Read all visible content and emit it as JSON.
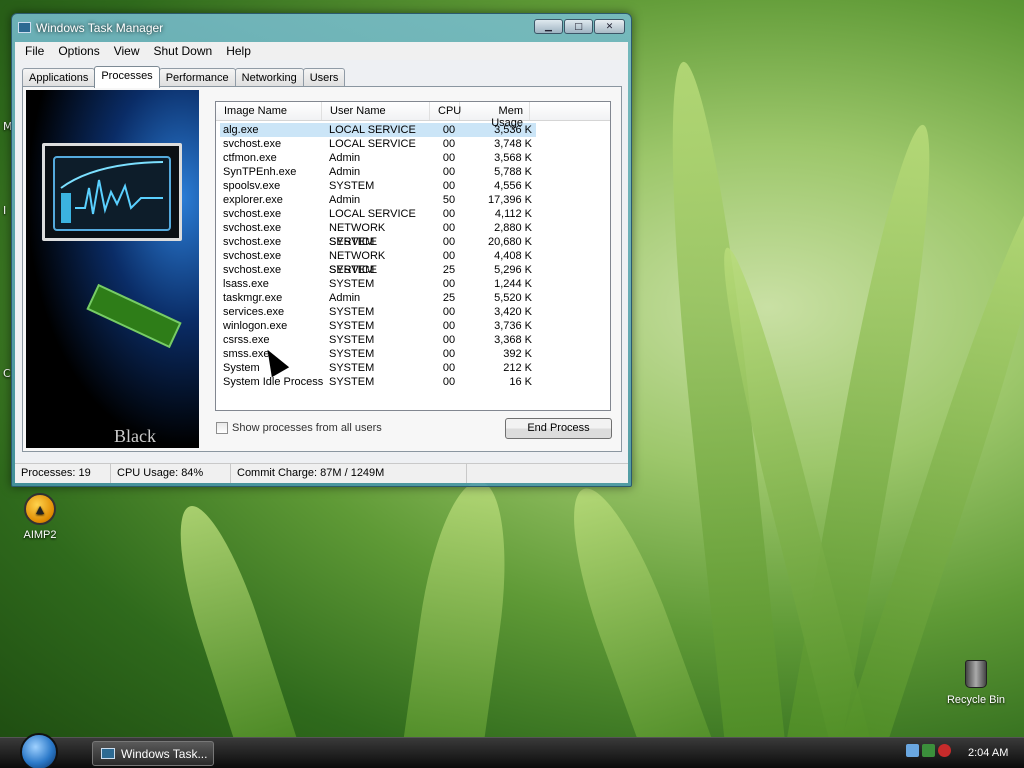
{
  "window": {
    "title": "Windows Task Manager",
    "controls": {
      "minimize": "▁",
      "maximize": "□",
      "close": "✕"
    }
  },
  "menu": [
    "File",
    "Options",
    "View",
    "Shut Down",
    "Help"
  ],
  "tabs": [
    "Applications",
    "Processes",
    "Performance",
    "Networking",
    "Users"
  ],
  "active_tab": "Processes",
  "side_art": {
    "brand_text": "Black Edition"
  },
  "table": {
    "columns": [
      "Image Name",
      "User Name",
      "CPU",
      "Mem Usage"
    ],
    "rows": [
      [
        "alg.exe",
        "LOCAL SERVICE",
        "00",
        "3,536 K"
      ],
      [
        "svchost.exe",
        "LOCAL SERVICE",
        "00",
        "3,748 K"
      ],
      [
        "ctfmon.exe",
        "Admin",
        "00",
        "3,568 K"
      ],
      [
        "SynTPEnh.exe",
        "Admin",
        "00",
        "5,788 K"
      ],
      [
        "spoolsv.exe",
        "SYSTEM",
        "00",
        "4,556 K"
      ],
      [
        "explorer.exe",
        "Admin",
        "50",
        "17,396 K"
      ],
      [
        "svchost.exe",
        "LOCAL SERVICE",
        "00",
        "4,112 K"
      ],
      [
        "svchost.exe",
        "NETWORK SERVICE",
        "00",
        "2,880 K"
      ],
      [
        "svchost.exe",
        "SYSTEM",
        "00",
        "20,680 K"
      ],
      [
        "svchost.exe",
        "NETWORK SERVICE",
        "00",
        "4,408 K"
      ],
      [
        "svchost.exe",
        "SYSTEM",
        "25",
        "5,296 K"
      ],
      [
        "lsass.exe",
        "SYSTEM",
        "00",
        "1,244 K"
      ],
      [
        "taskmgr.exe",
        "Admin",
        "25",
        "5,520 K"
      ],
      [
        "services.exe",
        "SYSTEM",
        "00",
        "3,420 K"
      ],
      [
        "winlogon.exe",
        "SYSTEM",
        "00",
        "3,736 K"
      ],
      [
        "csrss.exe",
        "SYSTEM",
        "00",
        "3,368 K"
      ],
      [
        "smss.exe",
        "SYSTEM",
        "00",
        "392 K"
      ],
      [
        "System",
        "SYSTEM",
        "00",
        "212 K"
      ],
      [
        "System Idle Process",
        "SYSTEM",
        "00",
        "16 K"
      ]
    ]
  },
  "show_all_label": "Show processes from all users",
  "end_process_label": "End Process",
  "status": {
    "processes": "Processes: 19",
    "cpu": "CPU Usage: 84%",
    "commit": "Commit Charge: 87M / 1249M"
  },
  "desktop": {
    "icons": [
      "AIMP2",
      "Recycle Bin"
    ],
    "edge_fragments": [
      "M",
      "I",
      "C"
    ]
  },
  "taskbar": {
    "task_button": "Windows Task...",
    "clock": "2:04 AM"
  },
  "colors": {
    "selection": "#cbe5f7",
    "taskbar": "#1a1a1a",
    "window_frame": "#5aa6c0"
  }
}
